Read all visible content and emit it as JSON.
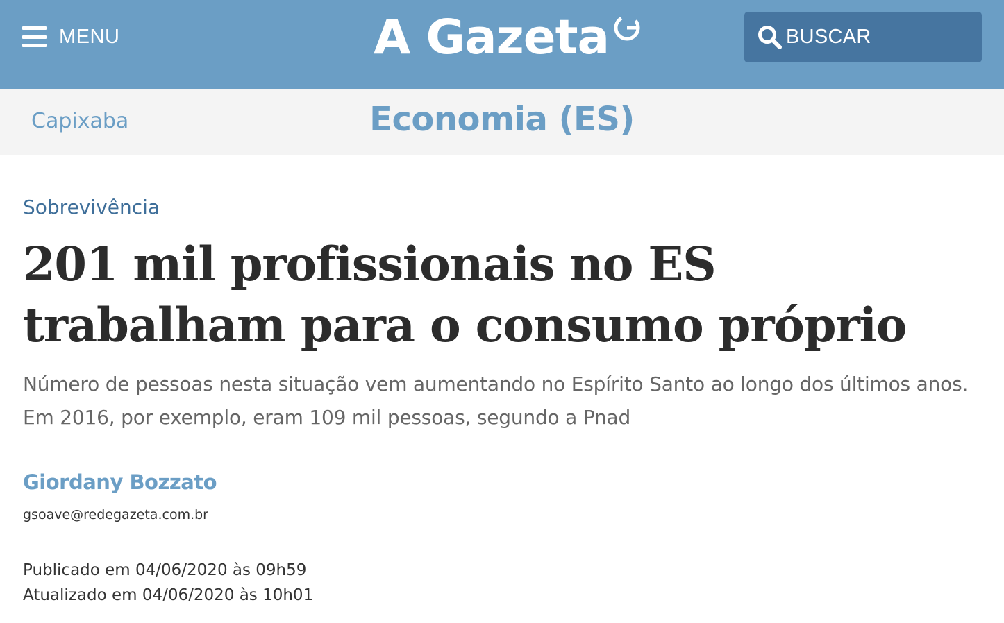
{
  "colors": {
    "brand": "#6b9ec5",
    "search_button": "#4675a0",
    "section_bar": "#f4f4f4",
    "kicker": "#3f6f9a",
    "headline": "#2c2c2c",
    "subtitle": "#666666"
  },
  "header": {
    "menu_icon": "hamburger-icon",
    "menu_label": "MENU",
    "logo_text": "A Gazeta",
    "logo_mark_icon": "gazeta-g-mark",
    "search_icon": "search-icon",
    "search_label": "BUSCAR"
  },
  "section": {
    "breadcrumb": "Capixaba",
    "title": "Economia (ES)"
  },
  "article": {
    "kicker": "Sobrevivência",
    "headline": "201 mil profissionais no ES trabalham para o consumo próprio",
    "subtitle": "Número de pessoas nesta situação vem aumentando no Espírito Santo ao longo dos últimos anos. Em 2016, por exemplo, eram 109 mil pessoas, segundo a Pnad",
    "author": {
      "name": "Giordany Bozzato",
      "email": "gsoave@redegazeta.com.br"
    },
    "published": "Publicado em 04/06/2020 às 09h59",
    "updated": "Atualizado em 04/06/2020 às 10h01"
  }
}
